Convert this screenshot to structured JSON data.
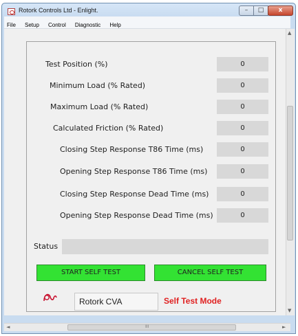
{
  "window": {
    "title": "Rotork Controls Ltd - Enlight.",
    "controls": {
      "minimize": "–",
      "maximize": "□",
      "close": "x"
    }
  },
  "menu": [
    "File",
    "Setup",
    "Control",
    "Diagnostic",
    "Help"
  ],
  "parameters": [
    {
      "label": "Test Position (%)",
      "value": "0"
    },
    {
      "label": "Minimum Load (% Rated)",
      "value": "0"
    },
    {
      "label": "Maximum Load (% Rated)",
      "value": "0"
    },
    {
      "label": "Calculated Friction (% Rated)",
      "value": "0"
    },
    {
      "label": "Closing Step Response T86 Time (ms)",
      "value": "0"
    },
    {
      "label": "Opening Step Response T86 Time (ms)",
      "value": "0"
    },
    {
      "label": "Closing Step Response Dead Time (ms)",
      "value": "0"
    },
    {
      "label": "Opening Step Response Dead Time (ms)",
      "value": "0"
    }
  ],
  "status": {
    "label": "Status",
    "value": ""
  },
  "buttons": {
    "start": "START SELF TEST",
    "cancel": "CANCEL SELF TEST"
  },
  "device": {
    "name": "Rotork CVA"
  },
  "mode": {
    "label": "Self Test Mode",
    "color": "#e02020"
  },
  "scrollbars": {
    "up": "▲",
    "down": "▼",
    "left": "◄",
    "right": "►",
    "grip": "III"
  },
  "colors": {
    "button_green": "#33e233",
    "field_gray": "#d8d8d8"
  }
}
